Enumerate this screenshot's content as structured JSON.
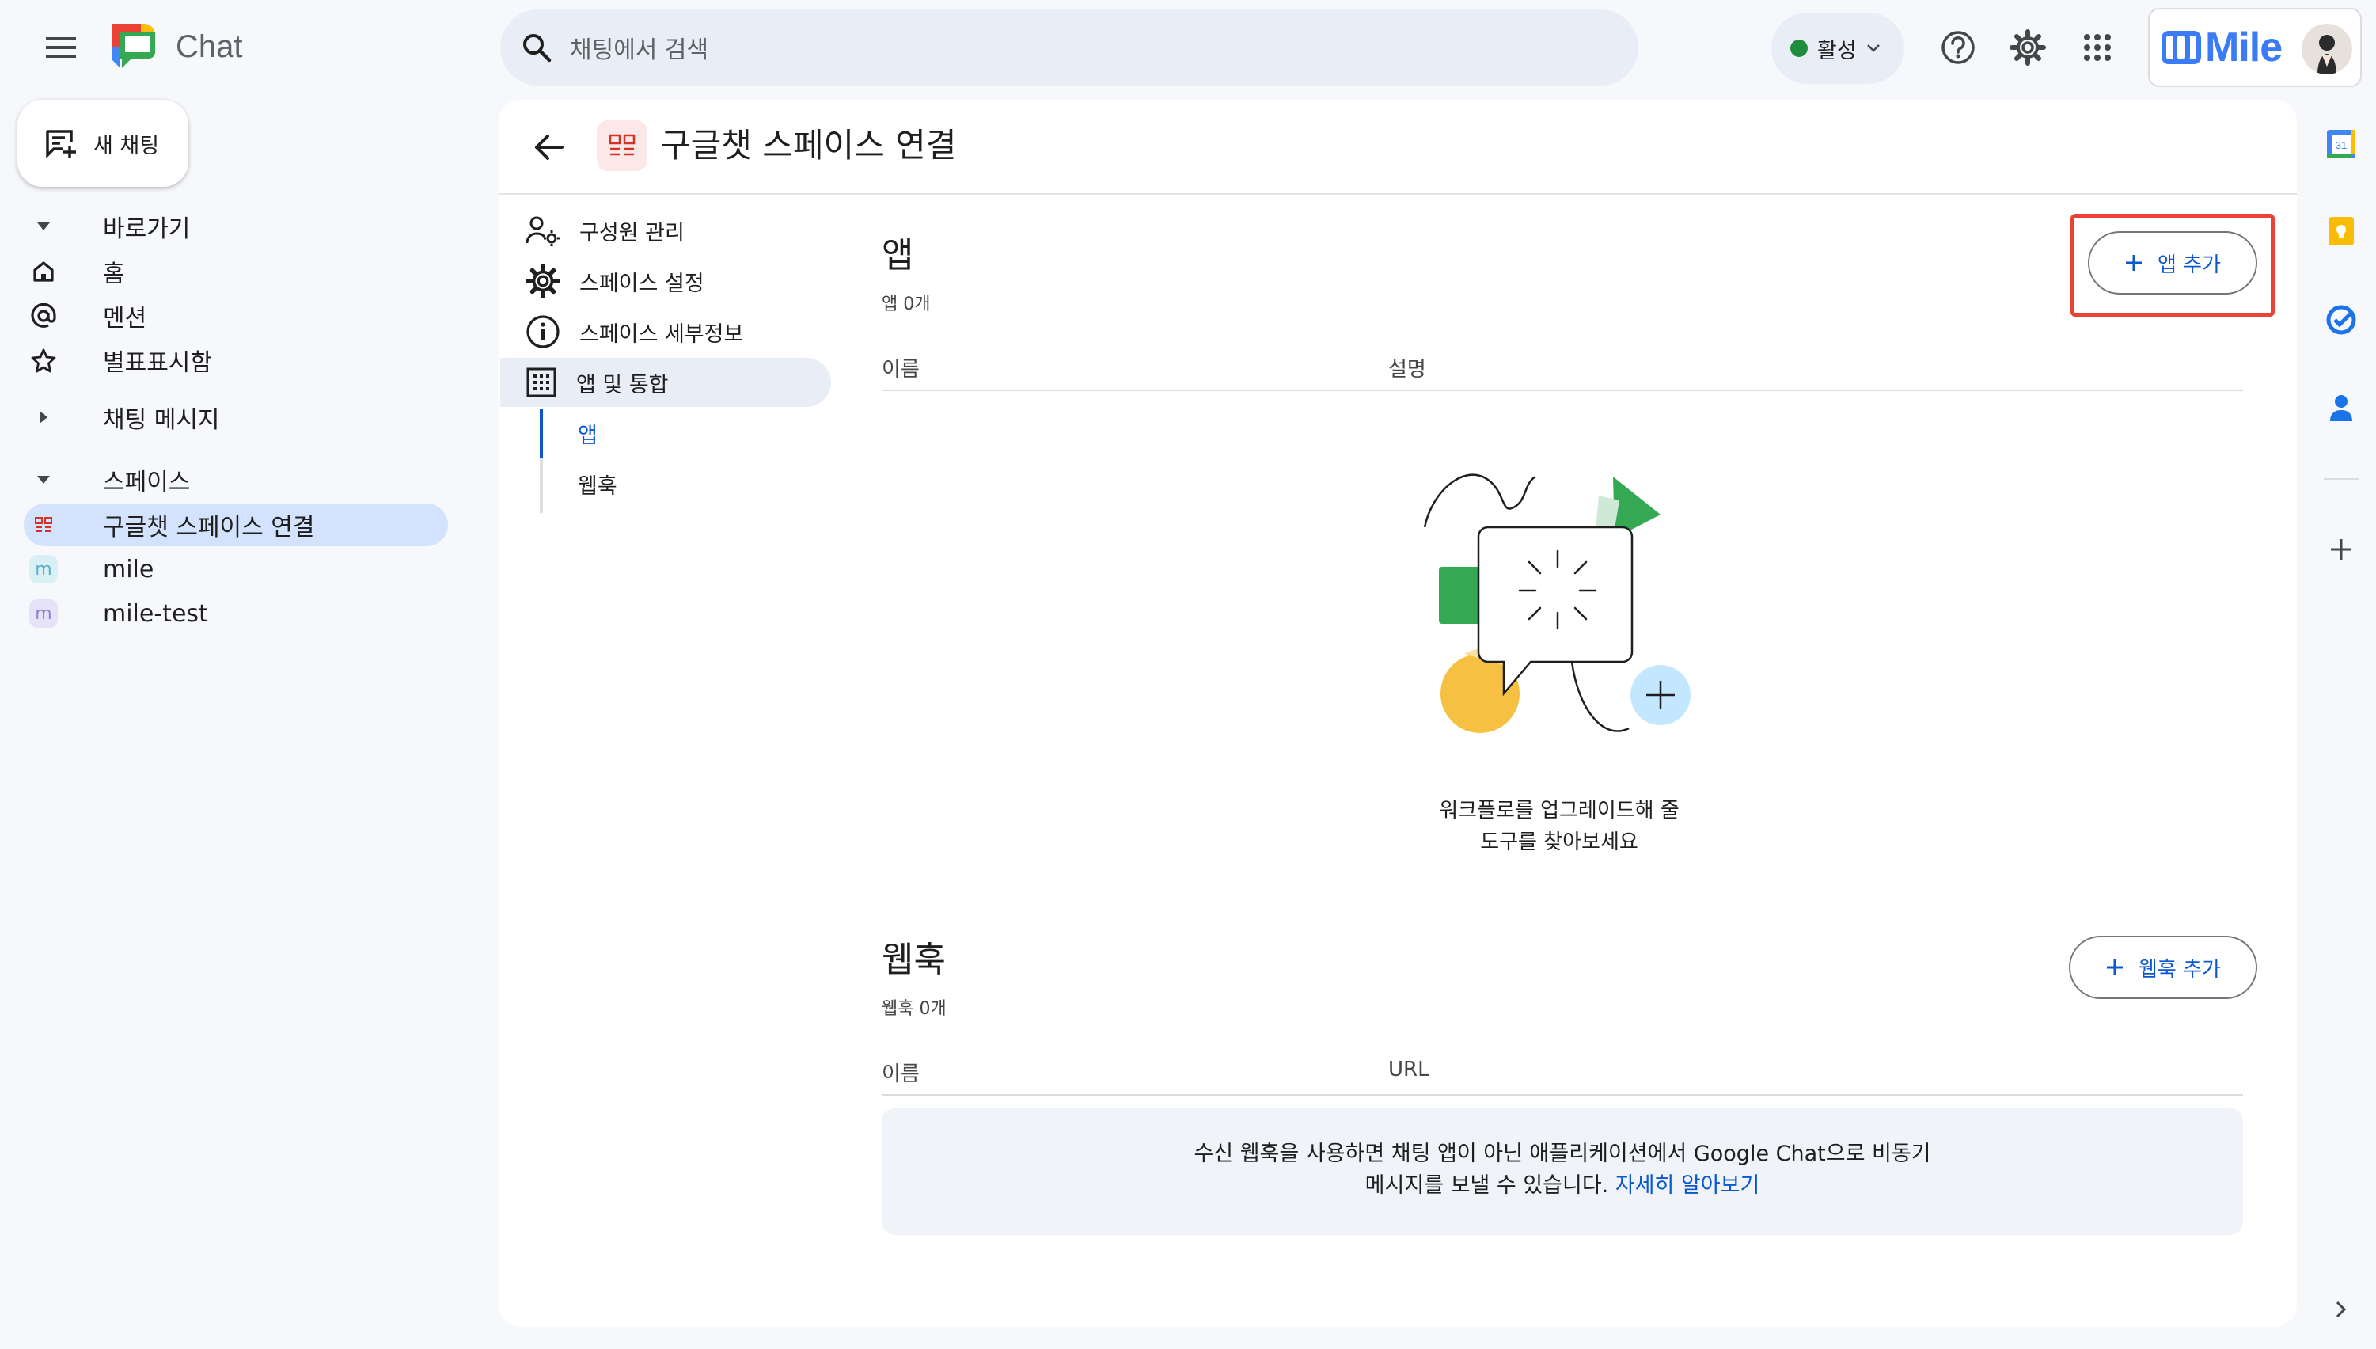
{
  "app": {
    "name": "Chat"
  },
  "search": {
    "placeholder": "채팅에서 검색"
  },
  "status": {
    "label": "활성"
  },
  "account": {
    "brand": "Mile"
  },
  "sidebar": {
    "new_chat": "새 채팅",
    "shortcuts_header": "바로가기",
    "items": [
      {
        "label": "홈",
        "icon": "home-icon"
      },
      {
        "label": "멘션",
        "icon": "at-icon"
      },
      {
        "label": "별표표시함",
        "icon": "star-icon"
      }
    ],
    "direct_messages": "채팅 메시지",
    "spaces_header": "스페이스",
    "spaces": [
      {
        "label": "구글챗 스페이스 연결",
        "selected": true,
        "chip": "grid"
      },
      {
        "label": "mile",
        "chip": "m"
      },
      {
        "label": "mile-test",
        "chip": "m"
      }
    ]
  },
  "space": {
    "title": "구글챗 스페이스 연결"
  },
  "settings_nav": {
    "items": [
      {
        "label": "구성원 관리",
        "icon": "manage-members-icon"
      },
      {
        "label": "스페이스 설정",
        "icon": "gear-icon"
      },
      {
        "label": "스페이스 세부정보",
        "icon": "info-icon"
      },
      {
        "label": "앱 및 통합",
        "icon": "apps-grid-icon",
        "selected": true
      }
    ],
    "sub_items": [
      {
        "label": "앱",
        "active": true
      },
      {
        "label": "웹훅"
      }
    ]
  },
  "apps_section": {
    "title": "앱",
    "count": "앱 0개",
    "add_button": "앱 추가",
    "columns": [
      "이름",
      "설명"
    ],
    "empty_line1": "워크플로를 업그레이드해 줄",
    "empty_line2": "도구를 찾아보세요"
  },
  "webhooks_section": {
    "title": "웹훅",
    "count": "웹훅 0개",
    "add_button": "웹훅 추가",
    "columns": [
      "이름",
      "URL"
    ],
    "info_line1": "수신 웹훅을 사용하면 채팅 앱이 아닌 애플리케이션에서 Google Chat으로 비동기",
    "info_line2": "메시지를 보낼 수 있습니다.",
    "learn_more": "자세히 알아보기"
  },
  "colors": {
    "accent": "#0b57d0",
    "selected_bg": "#d3e3fd",
    "highlight_border": "#ea4335",
    "status_green": "#1e8e3e"
  }
}
